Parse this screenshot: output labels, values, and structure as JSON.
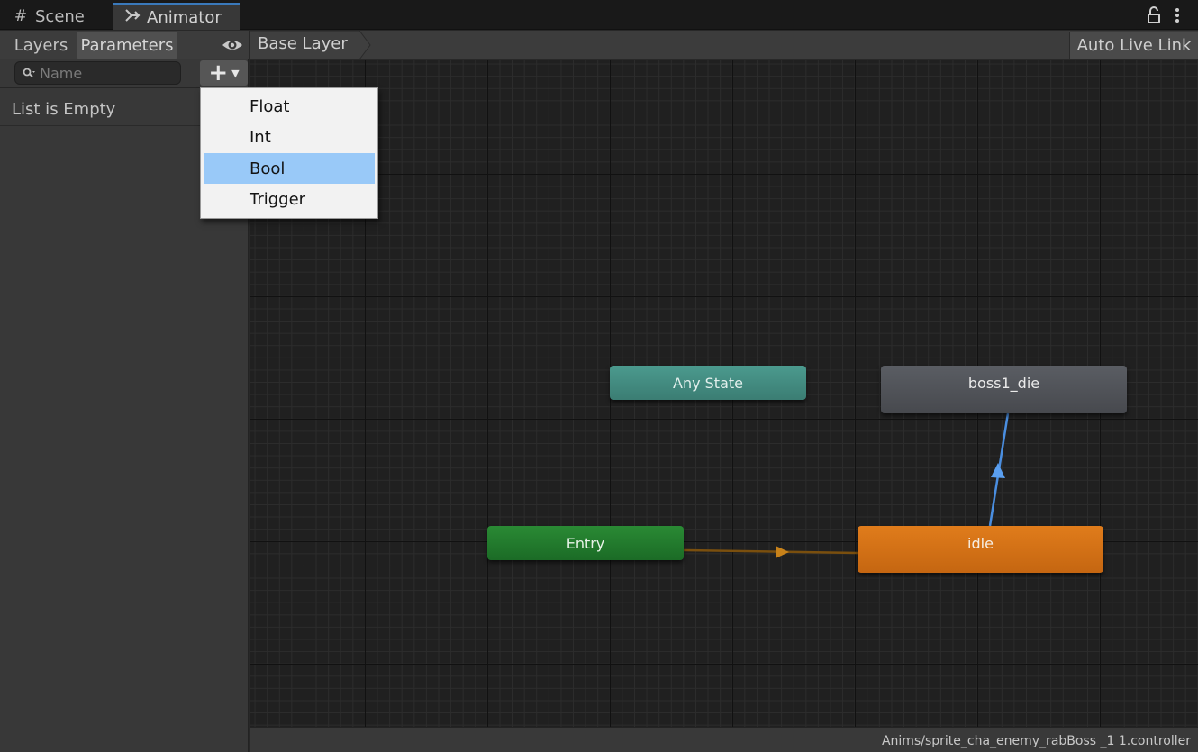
{
  "tabs": [
    {
      "label": "Scene",
      "icon": "grid-icon"
    },
    {
      "label": "Animator",
      "icon": "animator-icon",
      "active": true
    }
  ],
  "window_controls": {
    "lock_icon": "lock-icon",
    "menu_icon": "kebab-menu-icon"
  },
  "left_panel": {
    "tabs": [
      {
        "label": "Layers"
      },
      {
        "label": "Parameters",
        "active": true
      }
    ],
    "visibility_icon": "eye-icon",
    "search": {
      "placeholder": "Name",
      "value": "",
      "icon": "search-icon"
    },
    "add_button": {
      "icon": "plus-icon",
      "caret_icon": "caret-down-icon"
    },
    "empty_message": "List is Empty"
  },
  "breadcrumb": {
    "label": "Base Layer"
  },
  "auto_live_link": "Auto Live Link",
  "graph": {
    "states": [
      {
        "label": "Any State",
        "type": "any_state",
        "color": "#4a968a"
      },
      {
        "label": "boss1_die",
        "type": "state",
        "color": "#55585d"
      },
      {
        "label": "Entry",
        "type": "entry",
        "color": "#218030"
      },
      {
        "label": "idle",
        "type": "default_state",
        "color": "#d97416"
      }
    ],
    "transitions": [
      {
        "from": "Entry",
        "to": "idle",
        "color": "#7a4f0e"
      },
      {
        "from": "idle",
        "to": "boss1_die",
        "color": "#4a8ee0"
      }
    ]
  },
  "dropdown": {
    "items": [
      {
        "label": "Float"
      },
      {
        "label": "Int"
      },
      {
        "label": "Bool",
        "highlighted": true
      },
      {
        "label": "Trigger"
      }
    ],
    "highlight_color": "#99c9f8"
  },
  "status_bar": {
    "path": "Anims/sprite_cha_enemy_rabBoss _1 1.controller"
  }
}
